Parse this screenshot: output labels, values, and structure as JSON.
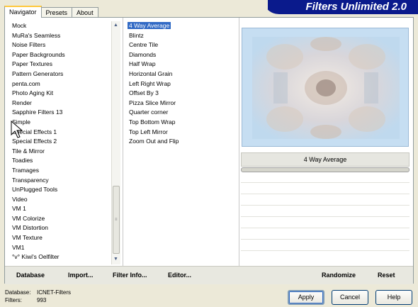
{
  "banner": {
    "title": "Filters Unlimited 2.0"
  },
  "tabs": [
    {
      "label": "Navigator",
      "active": true
    },
    {
      "label": "Presets",
      "active": false
    },
    {
      "label": "About",
      "active": false
    }
  ],
  "categories": [
    "Mock",
    "MuRa's Seamless",
    "Noise Filters",
    "Paper Backgrounds",
    "Paper Textures",
    "Pattern Generators",
    "penta.com",
    "Photo Aging Kit",
    "Render",
    "Sapphire Filters 13",
    "Simple",
    "Special Effects 1",
    "Special Effects 2",
    "Tile & Mirror",
    "Toadies",
    "Tramages",
    "Transparency",
    "UnPlugged Tools",
    "Video",
    "VM 1",
    "VM Colorize",
    "VM Distortion",
    "VM Texture",
    "VM1",
    "°v° Kiwi's Oelfilter"
  ],
  "filters": [
    "4 Way Average",
    "Blintz",
    "Centre Tile",
    "Diamonds",
    "Half Wrap",
    "Horizontal Grain",
    "Left Right Wrap",
    "Offset By 3",
    "Pizza Slice Mirror",
    "Quarter corner",
    "Top Bottom Wrap",
    "Top Left Mirror",
    "Zoom Out and Flip"
  ],
  "selected_filter": "4 Way Average",
  "preview": {
    "filter_name": "4 Way Average"
  },
  "bottom_bar": {
    "database_label": "Database",
    "import_label": "Import...",
    "filter_info_label": "Filter Info...",
    "editor_label": "Editor...",
    "randomize_label": "Randomize",
    "reset_label": "Reset"
  },
  "footer": {
    "database_key": "Database:",
    "database_value": "ICNET-Filters",
    "filters_key": "Filters:",
    "filters_value": "993"
  },
  "buttons": {
    "apply": "Apply",
    "cancel": "Cancel",
    "help": "Help"
  },
  "colors": {
    "banner": "#0a1a8c",
    "selection": "#316ac5",
    "preview_bg": "#cfe4f4"
  }
}
